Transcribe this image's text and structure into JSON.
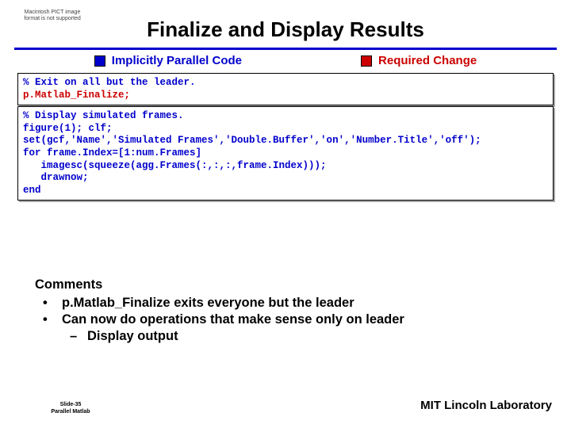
{
  "placeholder_text": "Macintosh PICT\nimage format\nis not supported",
  "title": "Finalize and Display Results",
  "legend": {
    "implicit": "Implicitly Parallel Code",
    "required": "Required Change"
  },
  "code1": {
    "comment": "% Exit on all but the leader.",
    "body": "p.Matlab_Finalize;"
  },
  "code2": {
    "comment": "% Display simulated frames.",
    "body": "figure(1); clf;\nset(gcf,'Name','Simulated Frames','Double.Buffer','on','Number.Title','off');\nfor frame.Index=[1:num.Frames]\n   imagesc(squeeze(agg.Frames(:,:,:,frame.Index)));\n   drawnow;\nend"
  },
  "comments": {
    "heading": "Comments",
    "bullets": [
      "p.Matlab_Finalize exits everyone but the leader",
      "Can now do operations that make sense only on leader"
    ],
    "sub": [
      "Display output"
    ]
  },
  "footer": {
    "slide": "Slide-35",
    "project": "Parallel Matlab",
    "lab": "MIT Lincoln Laboratory"
  }
}
